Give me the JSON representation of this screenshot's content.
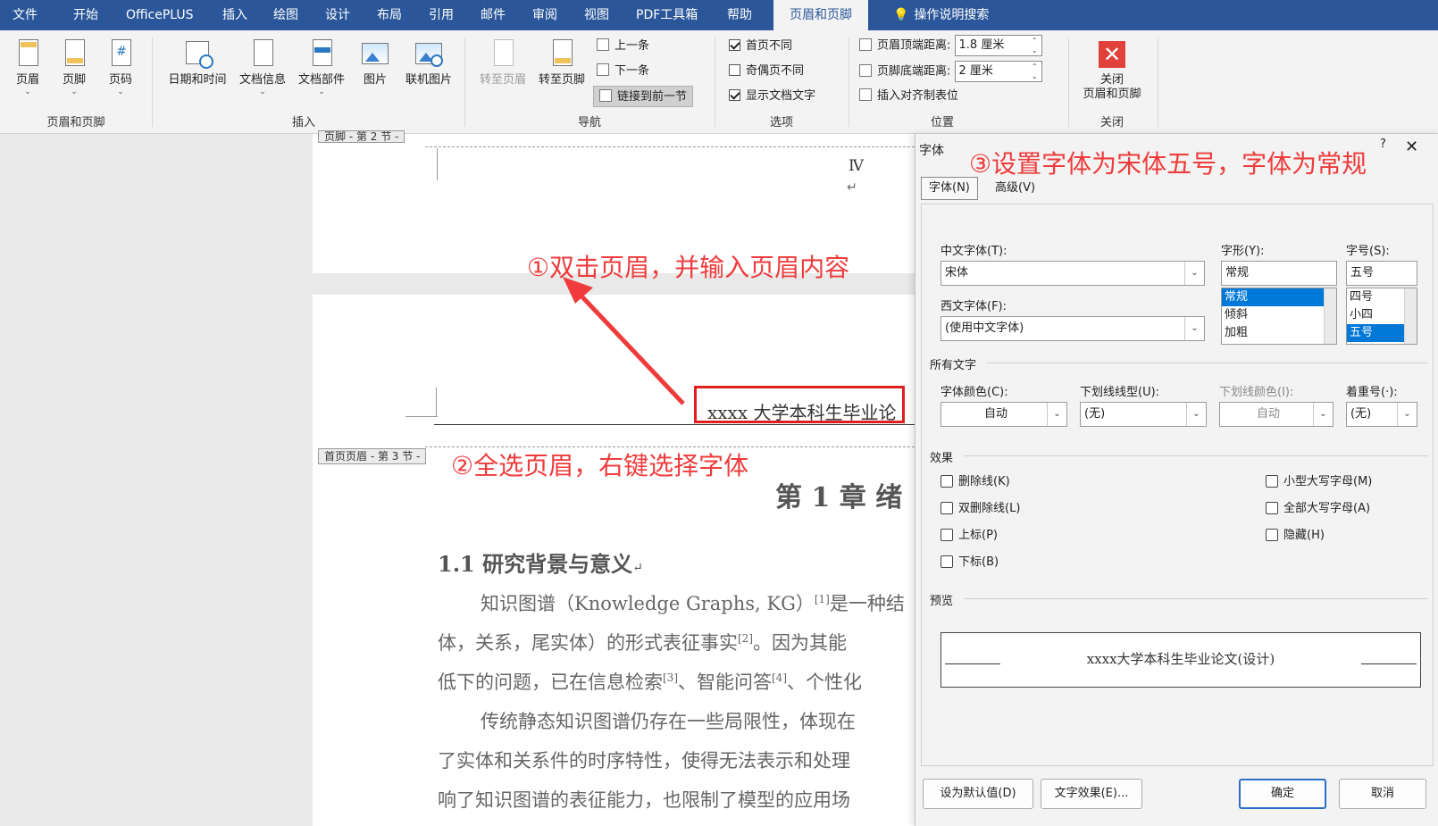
{
  "tabs": [
    "文件",
    "开始",
    "OfficePLUS",
    "插入",
    "绘图",
    "设计",
    "布局",
    "引用",
    "邮件",
    "审阅",
    "视图",
    "PDF工具箱",
    "帮助",
    "页眉和页脚",
    "操作说明搜索"
  ],
  "ribbon": {
    "hf_group": {
      "label": "页眉和页脚",
      "buttons": [
        "页眉",
        "页脚",
        "页码"
      ]
    },
    "insert_group": {
      "label": "插入",
      "buttons": [
        "日期和时间",
        "文档信息",
        "文档部件",
        "图片",
        "联机图片"
      ]
    },
    "nav_group": {
      "label": "导航",
      "goto_header": "转至页眉",
      "goto_footer": "转至页脚",
      "prev": "上一条",
      "next": "下一条",
      "link": "链接到前一节"
    },
    "options_group": {
      "label": "选项",
      "first_page": "首页不同",
      "odd_even": "奇偶页不同",
      "show_text": "显示文档文字"
    },
    "position_group": {
      "label": "位置",
      "header_top": "页眉顶端距离:",
      "header_top_value": "1.8 厘米",
      "footer_bottom": "页脚底端距离:",
      "footer_bottom_value": "2 厘米",
      "align_tab": "插入对齐制表位"
    },
    "close_group": {
      "label": "关闭",
      "close_line1": "关闭",
      "close_line2": "页眉和页脚"
    }
  },
  "document": {
    "footer_tag": "页脚 - 第 2 节 -",
    "page_number": "Ⅳ",
    "para_mark": "↵",
    "header_text": "xxxx 大学本科生毕业论",
    "header_tag": "首页页眉 - 第 3 节 -",
    "chapter_title": "第 1 章  绪",
    "section_title": "1.1  研究背景与意义",
    "lines": [
      {
        "text": "知识图谱（Knowledge Graphs, KG）",
        "sup": "[1]",
        "rest": "是一种结"
      },
      {
        "text": "体，关系，尾实体）的形式表征事实",
        "sup": "[2]",
        "rest": "。因为其能"
      },
      {
        "text": "低下的问题，已在信息检索",
        "sup": "[3]",
        "rest": "、智能问答",
        "sup2": "[4]",
        "rest2": "、个性化"
      },
      {
        "text": "传统静态知识图谱仍存在一些局限性，体现在",
        "sup": "",
        "rest": ""
      },
      {
        "text": "了实体和关系件的时序特性，使得无法表示和处理",
        "sup": "",
        "rest": ""
      },
      {
        "text": "响了知识图谱的表征能力，也限制了模型的应用场",
        "sup": "",
        "rest": ""
      }
    ]
  },
  "annotations": {
    "step1": "①双击页眉，并输入页眉内容",
    "step2": "②全选页眉，右键选择字体",
    "step3": "③设置字体为宋体五号，字体为常规"
  },
  "dialog": {
    "title": "字体",
    "help": "?",
    "close": "✕",
    "tab_font": "字体(N)",
    "tab_advanced": "高级(V)",
    "cn_font_label": "中文字体(T):",
    "cn_font_value": "宋体",
    "western_font_label": "西文字体(F):",
    "western_font_value": "(使用中文字体)",
    "style_label": "字形(Y):",
    "style_value": "常规",
    "style_options": [
      "常规",
      "倾斜",
      "加粗"
    ],
    "size_label": "字号(S):",
    "size_value": "五号",
    "size_options": [
      "四号",
      "小四",
      "五号"
    ],
    "all_text": "所有文字",
    "color_label": "字体颜色(C):",
    "color_value": "自动",
    "underline_label": "下划线线型(U):",
    "underline_value": "(无)",
    "underline_color_label": "下划线颜色(I):",
    "underline_color_value": "自动",
    "emphasis_label": "着重号(·):",
    "emphasis_value": "(无)",
    "effects": "效果",
    "effect_left": [
      "删除线(K)",
      "双删除线(L)",
      "上标(P)",
      "下标(B)"
    ],
    "effect_right": [
      "小型大写字母(M)",
      "全部大写字母(A)",
      "隐藏(H)"
    ],
    "preview_label": "预览",
    "preview_text": "xxxx大学本科生毕业论文(设计)",
    "btn_default": "设为默认值(D)",
    "btn_effects": "文字效果(E)...",
    "btn_ok": "确定",
    "btn_cancel": "取消"
  },
  "colors": {
    "accent": "#2b579a",
    "annotation": "#ef3b3b",
    "selection": "#0078d7",
    "highlight_box": "#e02020"
  }
}
